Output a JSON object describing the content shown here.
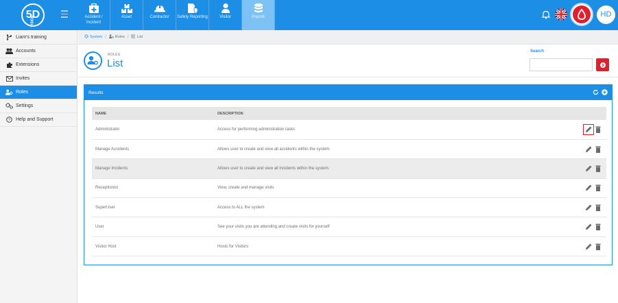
{
  "brand": {
    "logo_text": "5D",
    "logo_small": "VISION"
  },
  "modules": [
    {
      "label": "Accident / Incident",
      "icon": "first-aid-icon",
      "active": false
    },
    {
      "label": "Asset",
      "icon": "boxes-icon",
      "active": false
    },
    {
      "label": "Contractor",
      "icon": "hard-hat-icon",
      "active": false
    },
    {
      "label": "Safety Reporting",
      "icon": "report-shield-icon",
      "active": false
    },
    {
      "label": "Visitor",
      "icon": "person-icon",
      "active": false
    },
    {
      "label": "Payroll",
      "icon": "coins-icon",
      "active": true
    }
  ],
  "user": {
    "initials": "HD"
  },
  "sidebar": {
    "items": [
      {
        "label": "Liam's training",
        "icon": "branch-icon",
        "active": false
      },
      {
        "label": "Accounts",
        "icon": "users-icon",
        "active": false
      },
      {
        "label": "Extensions",
        "icon": "puzzle-icon",
        "active": false
      },
      {
        "label": "Invites",
        "icon": "envelope-icon",
        "active": false
      },
      {
        "label": "Roles",
        "icon": "user-key-icon",
        "active": true
      },
      {
        "label": "Settings",
        "icon": "cogs-icon",
        "active": false
      },
      {
        "label": "Help and Support",
        "icon": "help-circle-icon",
        "active": false
      }
    ]
  },
  "breadcrumb": {
    "system": "System",
    "roles": "Roles",
    "list": "List"
  },
  "page": {
    "subtitle": "ROLES",
    "title": "List"
  },
  "search": {
    "label": "Search",
    "placeholder": "",
    "value": ""
  },
  "results": {
    "title": "Results",
    "columns": {
      "name": "NAME",
      "description": "DESCRIPTION"
    },
    "rows": [
      {
        "name": "Administrator",
        "description": "Access for performing administration tasks"
      },
      {
        "name": "Manage Accidents",
        "description": "Allows user to create and view all accidents within the system."
      },
      {
        "name": "Manage Incidents",
        "description": "Allows user to create and view all incidents within the system."
      },
      {
        "name": "Receptionist",
        "description": "View, create and manage visits"
      },
      {
        "name": "SuperUser",
        "description": "Access to ALL the system"
      },
      {
        "name": "User",
        "description": "See your visits you are attending and create visits for yourself"
      },
      {
        "name": "Visitor Host",
        "description": "Hosts for Visitors"
      }
    ]
  },
  "colors": {
    "primary": "#1d8ee6",
    "danger": "#e0202c",
    "active_module": "#7ec2f5"
  }
}
